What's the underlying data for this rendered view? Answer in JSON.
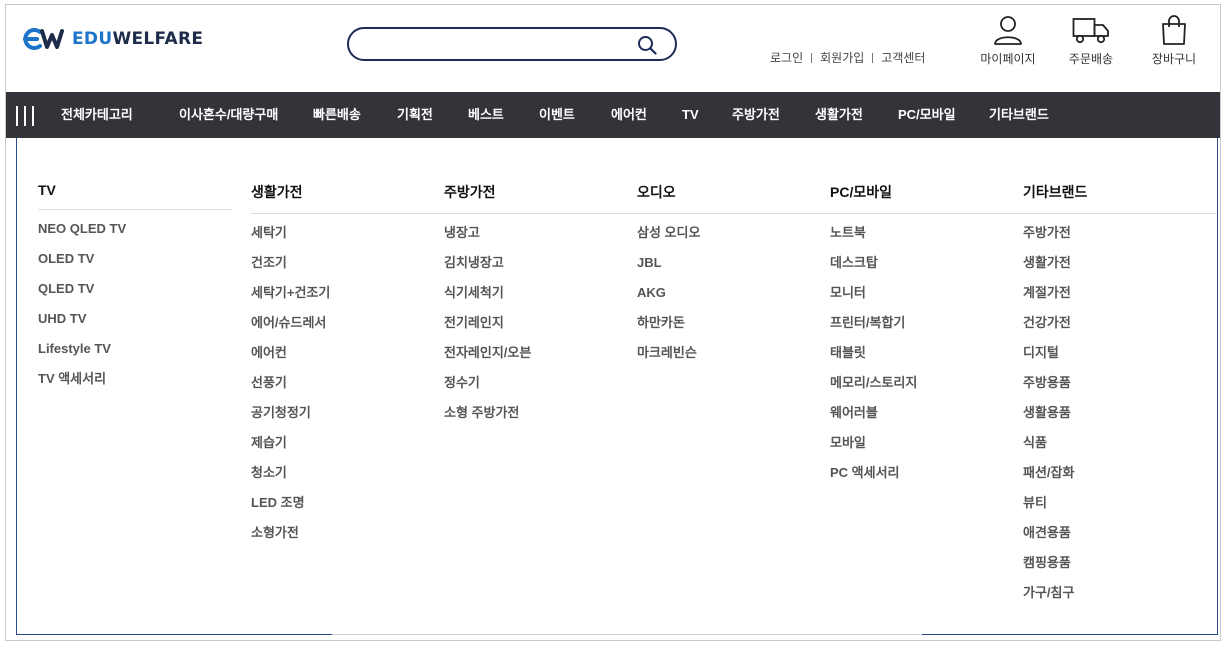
{
  "brand": {
    "logo_edu": "EDU",
    "logo_welfare": "WELFARE"
  },
  "search": {
    "value": "",
    "placeholder": ""
  },
  "util_links": [
    "로그인",
    "회원가입",
    "고객센터"
  ],
  "icons": [
    {
      "icon": "user-icon",
      "label": "마이페이지"
    },
    {
      "icon": "truck-icon",
      "label": "주문배송"
    },
    {
      "icon": "shopping-bag-icon",
      "label": "장바구니"
    }
  ],
  "nav": {
    "all_categories": "전체카테고리",
    "items": [
      "이사혼수/대량구매",
      "빠른배송",
      "기획전",
      "베스트",
      "이벤트",
      "에어컨",
      "TV",
      "주방가전",
      "생활가전",
      "PC/모바일",
      "기타브랜드"
    ]
  },
  "mega_menu": [
    {
      "title": "TV",
      "items": [
        "NEO QLED TV",
        "OLED TV",
        "QLED TV",
        "UHD TV",
        "Lifestyle TV",
        "TV 액세서리"
      ]
    },
    {
      "title": "생활가전",
      "items": [
        "세탁기",
        "건조기",
        "세탁기+건조기",
        "에어/슈드레서",
        "에어컨",
        "선풍기",
        "공기청정기",
        "제습기",
        "청소기",
        "LED 조명",
        "소형가전"
      ]
    },
    {
      "title": "주방가전",
      "items": [
        "냉장고",
        "김치냉장고",
        "식기세척기",
        "전기레인지",
        "전자레인지/오븐",
        "정수기",
        "소형 주방가전"
      ]
    },
    {
      "title": "오디오",
      "items": [
        "삼성 오디오",
        "JBL",
        "AKG",
        "하만카돈",
        "마크레빈슨"
      ]
    },
    {
      "title": "PC/모바일",
      "items": [
        "노트북",
        "데스크탑",
        "모니터",
        "프린터/복합기",
        "태블릿",
        "메모리/스토리지",
        "웨어러블",
        "모바일",
        "PC 액세서리"
      ]
    },
    {
      "title": "기타브랜드",
      "items": [
        "주방가전",
        "생활가전",
        "계절가전",
        "건강가전",
        "디지털",
        "주방용품",
        "생활용품",
        "식품",
        "패션/잡화",
        "뷰티",
        "애견용품",
        "캠핑용품",
        "가구/침구"
      ]
    }
  ],
  "colors": {
    "nav_bg": "#33343a",
    "brand_blue": "#1c75c9",
    "brand_navy": "#1e2c4a",
    "search_border": "#1d2b57"
  }
}
